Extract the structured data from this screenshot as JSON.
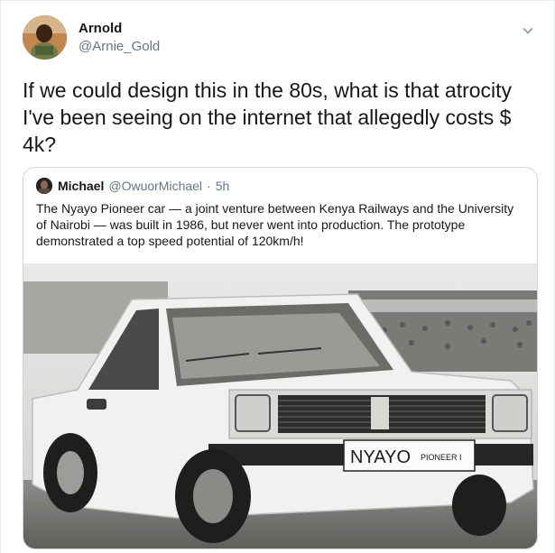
{
  "author": {
    "name": "Arnold",
    "handle": "@Arnie_Gold"
  },
  "tweet_text": "If we could design this in the 80s, what is that atrocity I've been seeing on the internet that allegedly costs $ 4k?",
  "quoted": {
    "name": "Michael",
    "handle": "@OwuorMichael",
    "separator": "·",
    "time": "5h",
    "text": "The Nyayo Pioneer car — a joint venture between Kenya Railways and the University of Nairobi — was built in 1986, but never went into production. The prototype demonstrated a top speed potential of 120km/h!",
    "image": {
      "plate_text": "NYAYO",
      "plate_subtext": "PIONEER I"
    }
  },
  "icons": {
    "menu": "chevron-down-icon"
  },
  "colors": {
    "secondary_text": "#657786",
    "border": "#ccd6dd",
    "primary_text": "#14171a"
  }
}
